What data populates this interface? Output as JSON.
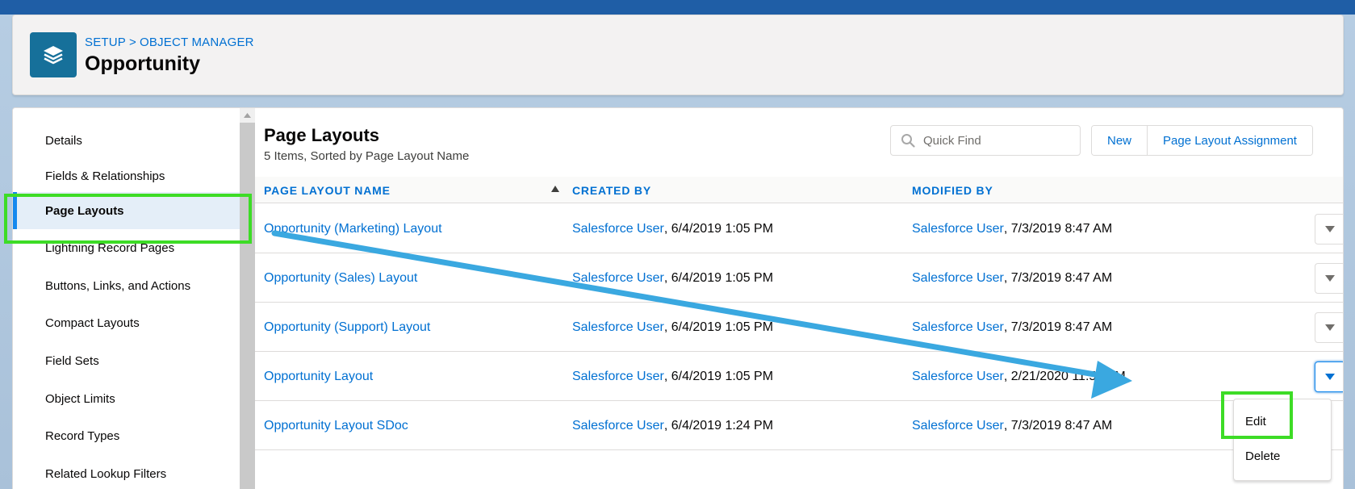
{
  "header": {
    "breadcrumb": [
      "SETUP",
      "OBJECT MANAGER"
    ],
    "breadcrumb_separator": ">",
    "title": "Opportunity",
    "icon": "layers-icon"
  },
  "sidebar": {
    "items": [
      {
        "label": "Details"
      },
      {
        "label": "Fields & Relationships"
      },
      {
        "label": "Page Layouts",
        "active": true
      },
      {
        "label": "Lightning Record Pages"
      },
      {
        "label": "Buttons, Links, and Actions"
      },
      {
        "label": "Compact Layouts"
      },
      {
        "label": "Field Sets"
      },
      {
        "label": "Object Limits"
      },
      {
        "label": "Record Types"
      },
      {
        "label": "Related Lookup Filters"
      }
    ]
  },
  "content": {
    "title": "Page Layouts",
    "subtitle": "5 Items, Sorted by Page Layout Name",
    "search_placeholder": "Quick Find",
    "buttons": {
      "new": "New",
      "assignment": "Page Layout Assignment"
    },
    "columns": [
      "PAGE LAYOUT NAME",
      "CREATED BY",
      "MODIFIED BY"
    ],
    "rows": [
      {
        "name": "Opportunity (Marketing) Layout",
        "created_user": "Salesforce User",
        "created_date": ", 6/4/2019 1:05 PM",
        "modified_user": "Salesforce User",
        "modified_date": ", 7/3/2019 8:47 AM"
      },
      {
        "name": "Opportunity (Sales) Layout",
        "created_user": "Salesforce User",
        "created_date": ", 6/4/2019 1:05 PM",
        "modified_user": "Salesforce User",
        "modified_date": ", 7/3/2019 8:47 AM"
      },
      {
        "name": "Opportunity (Support) Layout",
        "created_user": "Salesforce User",
        "created_date": ", 6/4/2019 1:05 PM",
        "modified_user": "Salesforce User",
        "modified_date": ", 7/3/2019 8:47 AM"
      },
      {
        "name": "Opportunity Layout",
        "created_user": "Salesforce User",
        "created_date": ", 6/4/2019 1:05 PM",
        "modified_user": "Salesforce User",
        "modified_date": ", 2/21/2020 11:58 AM"
      },
      {
        "name": "Opportunity Layout SDoc",
        "created_user": "Salesforce User",
        "created_date": ", 6/4/2019 1:24 PM",
        "modified_user": "Salesforce User",
        "modified_date": ", 7/3/2019 8:47 AM"
      }
    ],
    "row_menu": [
      "Edit",
      "Delete"
    ]
  },
  "colors": {
    "brand_blue": "#0070d2",
    "highlight_green": "#3ddc26",
    "annotation_arrow": "#3aa8e0",
    "header_icon_bg": "#16709a"
  }
}
